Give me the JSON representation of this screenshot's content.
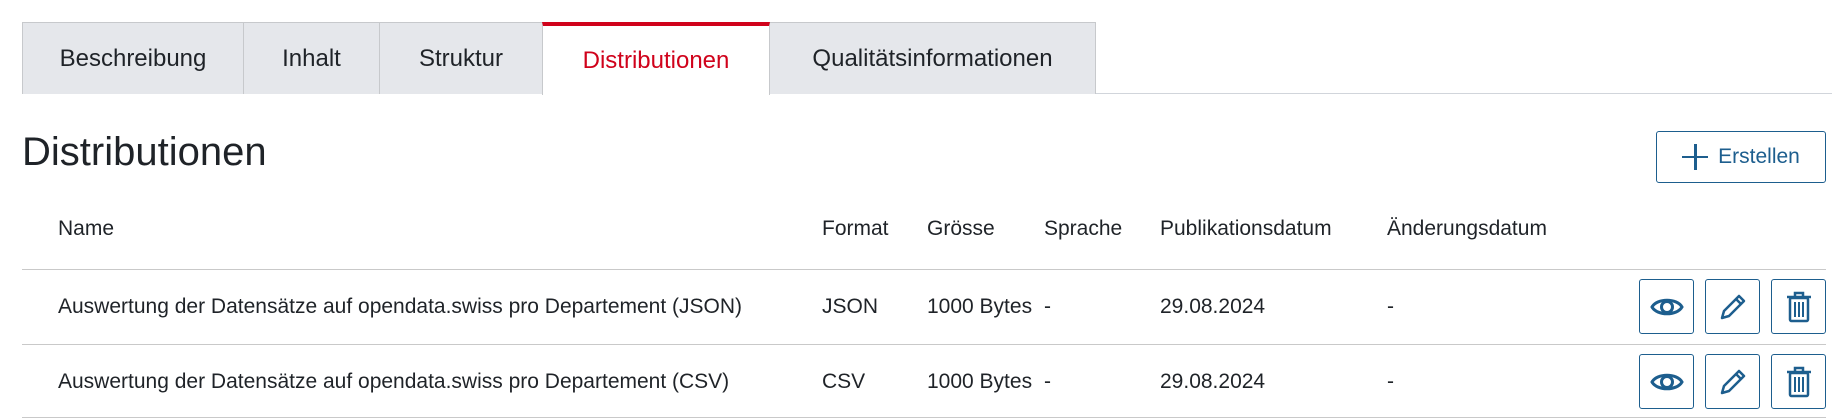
{
  "tabs": [
    {
      "label": "Beschreibung",
      "active": false
    },
    {
      "label": "Inhalt",
      "active": false
    },
    {
      "label": "Struktur",
      "active": false
    },
    {
      "label": "Distributionen",
      "active": true
    },
    {
      "label": "Qualitätsinformationen",
      "active": false
    }
  ],
  "page_title": "Distributionen",
  "create_button": {
    "label": "Erstellen",
    "icon": "plus-icon"
  },
  "table": {
    "headers": {
      "name": "Name",
      "format": "Format",
      "size": "Grösse",
      "language": "Sprache",
      "published": "Publikationsdatum",
      "modified": "Änderungsdatum"
    },
    "rows": [
      {
        "name": "Auswertung der Datensätze auf opendata.swiss pro Departement (JSON)",
        "format": "JSON",
        "size": "1000 Bytes",
        "language": "-",
        "published": "29.08.2024",
        "modified": "-"
      },
      {
        "name": "Auswertung der Datensätze auf opendata.swiss pro Departement (CSV)",
        "format": "CSV",
        "size": "1000 Bytes",
        "language": "-",
        "published": "29.08.2024",
        "modified": "-"
      }
    ],
    "row_actions": [
      "eye-icon",
      "pencil-icon",
      "trash-icon"
    ]
  },
  "colors": {
    "accent_red": "#d0021b",
    "action_blue": "#1d5e8e",
    "tab_background": "#e5e7eb"
  }
}
